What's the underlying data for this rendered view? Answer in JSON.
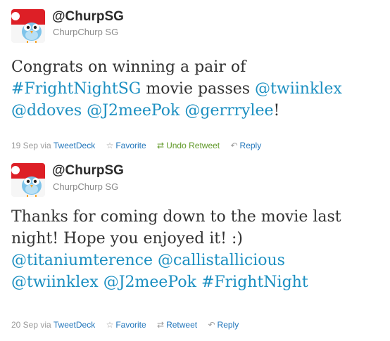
{
  "tweets": [
    {
      "screen_name": "@ChurpSG",
      "full_name": "ChurpChurp SG",
      "lines": [
        [
          {
            "t": "Congrats on winning a pair of",
            "link": false
          }
        ],
        [
          {
            "t": "#FrightNightSG",
            "link": true
          },
          {
            "t": " movie passes ",
            "link": false
          },
          {
            "t": "@twiinklex",
            "link": true
          }
        ],
        [
          {
            "t": "@ddoves",
            "link": true
          },
          {
            "t": " ",
            "link": false
          },
          {
            "t": "@J2meePok",
            "link": true
          },
          {
            "t": " ",
            "link": false
          },
          {
            "t": "@gerrrylee",
            "link": true
          },
          {
            "t": "!",
            "link": false
          }
        ]
      ],
      "date": "19 Sep",
      "via": "via",
      "source": "TweetDeck",
      "actions": [
        {
          "label": "Favorite",
          "icon": "star-icon",
          "glyph": "☆"
        },
        {
          "label": "Undo Retweet",
          "icon": "retweet-icon",
          "glyph": "⇄"
        },
        {
          "label": "Reply",
          "icon": "reply-icon",
          "glyph": "↶"
        }
      ]
    },
    {
      "screen_name": "@ChurpSG",
      "full_name": "ChurpChurp SG",
      "lines": [
        [
          {
            "t": "Thanks for coming down to the movie last",
            "link": false
          }
        ],
        [
          {
            "t": "night! Hope you enjoyed it! :)",
            "link": false
          }
        ],
        [
          {
            "t": "@titaniumterence",
            "link": true
          },
          {
            "t": " ",
            "link": false
          },
          {
            "t": "@callistallicious",
            "link": true
          }
        ],
        [
          {
            "t": "@twiinklex",
            "link": true
          },
          {
            "t": " ",
            "link": false
          },
          {
            "t": "@J2meePok",
            "link": true
          },
          {
            "t": " ",
            "link": false
          },
          {
            "t": "#FrightNight",
            "link": true
          }
        ]
      ],
      "date": "20 Sep",
      "via": "via",
      "source": "TweetDeck",
      "actions": [
        {
          "label": "Favorite",
          "icon": "star-icon",
          "glyph": "☆"
        },
        {
          "label": "Retweet",
          "icon": "retweet-icon",
          "glyph": "⇄"
        },
        {
          "label": "Reply",
          "icon": "reply-icon",
          "glyph": "↶"
        }
      ]
    }
  ],
  "colors": {
    "link": "#1b8fc1",
    "retweeted": "#609928",
    "meta": "#999999"
  }
}
